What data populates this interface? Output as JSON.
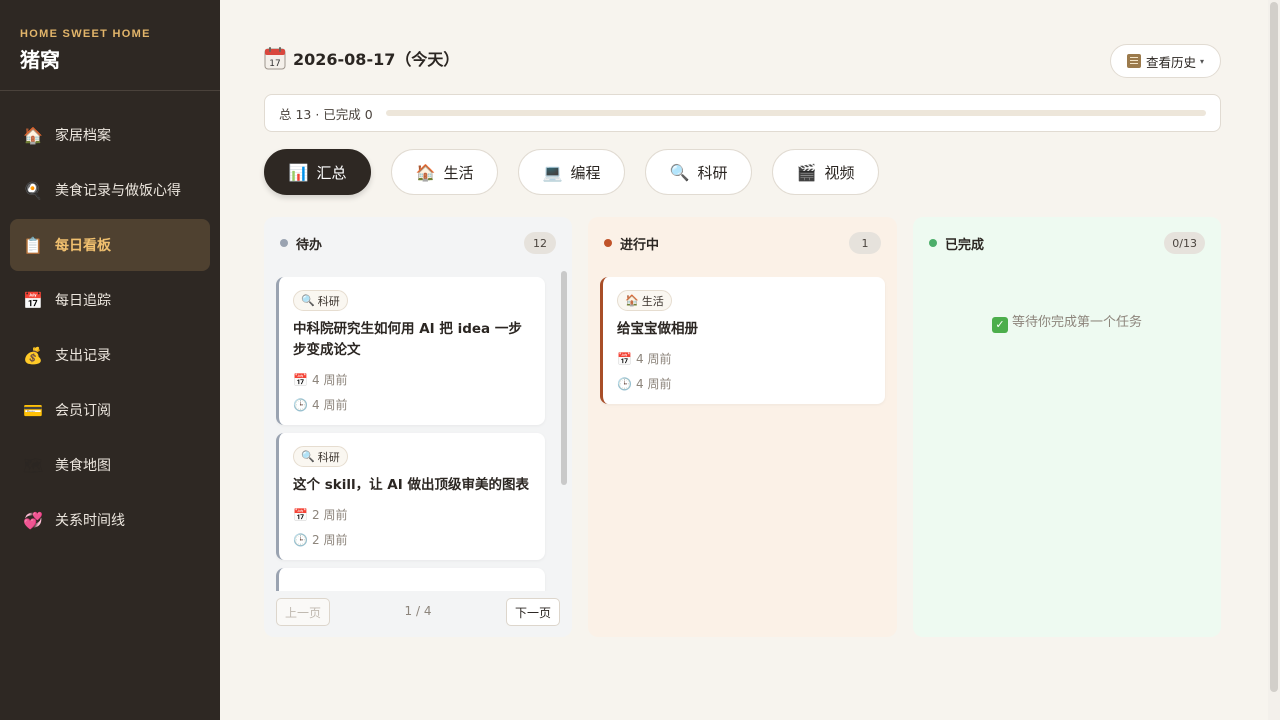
{
  "sidebar": {
    "brand_sub": "HOME SWEET HOME",
    "brand_title": "猪窝",
    "items": [
      {
        "label": "家居档案",
        "icon": "🏠"
      },
      {
        "label": "美食记录与做饭心得",
        "icon": "🍳"
      },
      {
        "label": "每日看板",
        "icon": "📋",
        "active": true
      },
      {
        "label": "每日追踪",
        "icon": "📅"
      },
      {
        "label": "支出记录",
        "icon": "💰"
      },
      {
        "label": "会员订阅",
        "icon": "💳"
      },
      {
        "label": "美食地图",
        "icon": "🗺"
      },
      {
        "label": "关系时间线",
        "icon": "💞"
      }
    ]
  },
  "header": {
    "date_title": "2026-08-17（今天）",
    "history_label": "查看历史",
    "history_caret": "▾"
  },
  "progress": {
    "text": "总 13 · 已完成 0",
    "fraction": 0.0
  },
  "tabs": [
    {
      "label": "汇总",
      "icon": "📊",
      "active": true
    },
    {
      "label": "生活",
      "icon": "🏠"
    },
    {
      "label": "编程",
      "icon": "💻"
    },
    {
      "label": "科研",
      "icon": "🔍"
    },
    {
      "label": "视频",
      "icon": "🎬"
    }
  ],
  "columns": {
    "todo": {
      "title": "待办",
      "count": "12",
      "color": "#9aa3b1",
      "cards": [
        {
          "tag": "科研",
          "tag_icon": "🔍",
          "title": "中科院研究生如何用 AI 把 idea 一步步变成论文",
          "created": "4 周前",
          "updated": "4 周前"
        },
        {
          "tag": "科研",
          "tag_icon": "🔍",
          "title": "这个 skill，让 AI 做出顶级审美的图表",
          "created": "2 周前",
          "updated": "2 周前"
        }
      ],
      "pager": {
        "prev": "上一页",
        "info": "1 / 4",
        "next": "下一页"
      }
    },
    "doing": {
      "title": "进行中",
      "count": "1",
      "color": "#c0532a",
      "cards": [
        {
          "tag": "生活",
          "tag_icon": "🏠",
          "title": "给宝宝做相册",
          "created": "4 周前",
          "updated": "4 周前"
        }
      ]
    },
    "done": {
      "title": "已完成",
      "count": "0/13",
      "color": "#4cae6a",
      "empty_text": "等待你完成第一个任务",
      "empty_icon": "✓"
    }
  },
  "icons": {
    "calendar": "📅",
    "clock": "🕒"
  }
}
